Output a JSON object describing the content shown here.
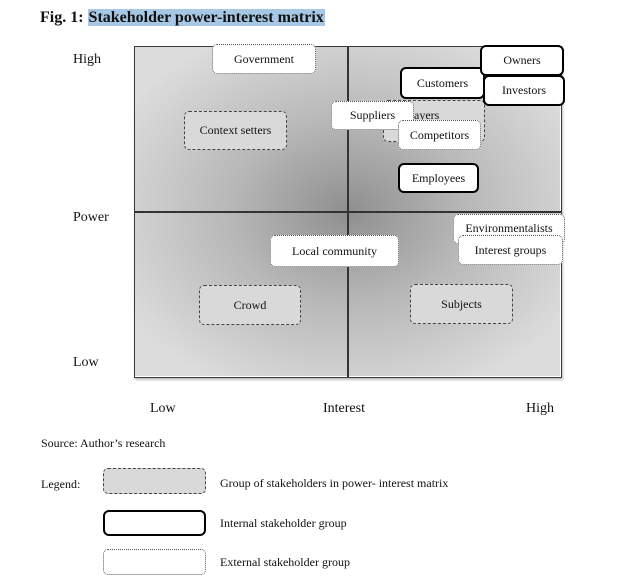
{
  "figure": {
    "title_prefix": "Fig. 1: ",
    "title_highlight": "Stakeholder power-interest matrix"
  },
  "axes": {
    "y_high": "High",
    "y_label": "Power",
    "y_low": "Low",
    "x_low": "Low",
    "x_label": "Interest",
    "x_high": "High"
  },
  "stakeholders": {
    "government": {
      "label": "Government",
      "type": "external"
    },
    "context_setters": {
      "label": "Context setters",
      "type": "group"
    },
    "owners": {
      "label": "Owners",
      "type": "internal"
    },
    "customers": {
      "label": "Customers",
      "type": "internal"
    },
    "investors": {
      "label": "Investors",
      "type": "internal"
    },
    "players": {
      "label": "Players",
      "type": "group"
    },
    "suppliers": {
      "label": "Suppliers",
      "type": "external"
    },
    "competitors": {
      "label": "Competitors",
      "type": "external"
    },
    "employees": {
      "label": "Employees",
      "type": "internal"
    },
    "environmentalists": {
      "label": "Environmentalists",
      "type": "external"
    },
    "interest_groups": {
      "label": "Interest groups",
      "type": "external"
    },
    "local_community": {
      "label": "Local community",
      "type": "external"
    },
    "crowd": {
      "label": "Crowd",
      "type": "group"
    },
    "subjects": {
      "label": "Subjects",
      "type": "group"
    }
  },
  "source": "Source: Author’s research",
  "legend": {
    "label": "Legend:",
    "items": [
      {
        "type": "group",
        "text": "Group of stakeholders in power- interest matrix"
      },
      {
        "type": "internal",
        "text": "Internal stakeholder group"
      },
      {
        "type": "external",
        "text": "External stakeholder group"
      }
    ]
  },
  "colors": {
    "title_highlight": "#a7c8e4",
    "group_fill": "#d9d9d9",
    "box_fill": "#ffffff"
  }
}
